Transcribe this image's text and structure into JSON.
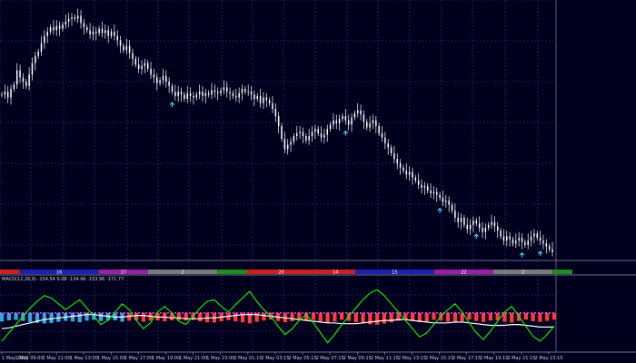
{
  "chart_data": {
    "type": "candlestick",
    "colors": {
      "background": "#00001e",
      "grid": "#3a3a6a",
      "candle": "#ffffff",
      "arrow": "#39d5ff",
      "macd_line": "#00ff00",
      "signal_line": "#ffffff",
      "hist_pos": "#2fa8e8",
      "hist_neg": "#ff3b3b",
      "level_line": "#ff44ff"
    },
    "close_series": [
      119,
      121,
      117,
      123,
      126,
      136,
      131,
      128,
      125,
      133,
      141,
      146,
      149,
      155,
      160,
      163,
      166,
      164,
      167,
      165,
      168,
      170,
      172,
      173,
      172,
      174,
      169,
      166,
      164,
      161,
      163,
      162,
      165,
      162,
      164,
      160,
      163,
      160,
      157,
      153,
      150,
      153,
      148,
      144,
      140,
      137,
      139,
      141,
      137,
      133,
      131,
      127,
      129,
      132,
      128,
      125,
      121,
      118,
      121,
      119,
      116,
      120,
      118,
      117,
      119,
      121,
      118,
      120,
      119,
      122,
      121,
      120,
      122,
      124,
      121,
      120,
      118,
      117,
      120,
      123,
      121,
      121,
      119,
      116,
      118,
      113,
      117,
      115,
      113,
      109,
      104,
      97,
      88,
      81,
      84,
      86,
      90,
      92,
      93,
      90,
      87,
      90,
      93,
      95,
      92,
      89,
      91,
      95,
      98,
      101,
      99,
      102,
      104,
      101,
      98,
      103,
      106,
      108,
      105,
      100,
      96,
      99,
      101,
      97,
      92,
      89,
      85,
      82,
      78,
      74,
      71,
      68,
      66,
      63,
      65,
      61,
      59,
      56,
      54,
      55,
      52,
      50,
      51,
      49,
      47,
      44,
      45,
      42,
      38,
      33,
      30,
      33,
      28,
      25,
      28,
      31,
      29,
      26,
      23,
      26,
      28,
      30,
      27,
      24,
      20,
      17,
      20,
      18,
      15,
      17,
      19,
      16,
      14,
      17,
      20,
      22,
      19,
      17,
      15,
      13,
      11,
      9
    ],
    "candle_width": 1.5,
    "buy_arrows": [
      56,
      113,
      144,
      156,
      171,
      177,
      184,
      188,
      192,
      197,
      203
    ],
    "segments": [
      {
        "label": "",
        "color": "#cc2020",
        "len": 2
      },
      {
        "label": "16",
        "color": "#1f1fb0",
        "len": 8
      },
      {
        "label": "17",
        "color": "#9b1fa3",
        "len": 5
      },
      {
        "label": "2",
        "color": "#7a7a7a",
        "len": 7
      },
      {
        "label": "",
        "color": "#1e8c1e",
        "len": 3
      },
      {
        "label": "20",
        "color": "#cc2020",
        "len": 7
      },
      {
        "label": "14",
        "color": "#cc2020",
        "len": 4
      },
      {
        "label": "15",
        "color": "#1f1fb0",
        "len": 8
      },
      {
        "label": "22",
        "color": "#9b1fa3",
        "len": 6
      },
      {
        "label": "2",
        "color": "#7a7a7a",
        "len": 6
      },
      {
        "label": "",
        "color": "#1e8c1e",
        "len": 2
      }
    ],
    "indicator_label": "MACD(12,26,9) -154.54 0.08 -134.96 -153.96 -171.77",
    "macd_line": [
      -30,
      -20,
      -10,
      0,
      10,
      18,
      25,
      22,
      15,
      8,
      14,
      20,
      10,
      0,
      -10,
      -5,
      5,
      15,
      8,
      -5,
      -15,
      -8,
      5,
      12,
      4,
      -6,
      -10,
      0,
      10,
      18,
      20,
      12,
      5,
      14,
      22,
      30,
      18,
      8,
      0,
      -12,
      -22,
      -15,
      -5,
      2,
      -8,
      -20,
      -32,
      -22,
      -10,
      0,
      10,
      20,
      28,
      32,
      25,
      15,
      5,
      -5,
      -15,
      -25,
      -20,
      -10,
      0,
      8,
      15,
      5,
      -8,
      -20,
      -28,
      -18,
      -6,
      5,
      12,
      0,
      -12,
      -24,
      -30,
      -22,
      -12
    ],
    "signal_line": [
      -15,
      -14,
      -12,
      -10,
      -8,
      -6,
      -4,
      -3,
      -2,
      -1,
      0,
      1,
      2,
      2,
      1,
      0,
      -1,
      -1,
      0,
      1,
      1,
      0,
      -1,
      -1,
      -2,
      -2,
      -3,
      -3,
      -3,
      -2,
      -2,
      -1,
      0,
      1,
      2,
      2,
      2,
      1,
      0,
      -1,
      -2,
      -3,
      -4,
      -5,
      -6,
      -7,
      -8,
      -8,
      -9,
      -9,
      -9,
      -8,
      -7,
      -6,
      -5,
      -5,
      -4,
      -4,
      -5,
      -6,
      -7,
      -8,
      -8,
      -8,
      -7,
      -7,
      -8,
      -9,
      -10,
      -11,
      -11,
      -11,
      -10,
      -10,
      -11,
      -12,
      -13,
      -13,
      -13
    ],
    "macd_ylim": [
      -40,
      40
    ],
    "level_value": 0,
    "x_tick_labels": [
      "1 May 2009",
      "1 May 09:00",
      "1 May 11:00",
      "1 May 13:00",
      "1 May 15:00",
      "1 May 17:00",
      "1 May 19:00",
      "1 May 21:00",
      "1 May 23:00",
      "2 May 01:15",
      "2 May 03:15",
      "2 May 05:15",
      "2 May 07:15",
      "2 May 09:15",
      "2 May 11:15",
      "2 May 13:15",
      "2 May 15:15",
      "2 May 17:15",
      "2 May 19:15",
      "2 May 21:15",
      "2 May 23:15"
    ],
    "ylim": [
      0,
      180
    ]
  }
}
